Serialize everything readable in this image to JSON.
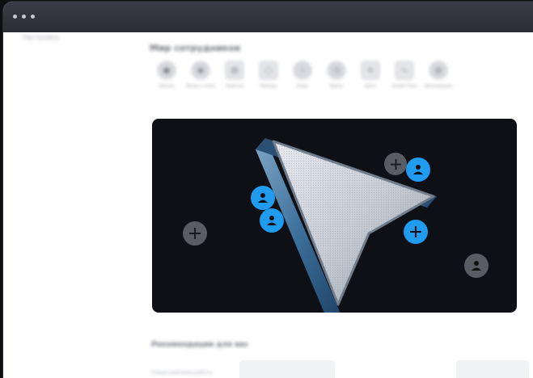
{
  "window": {
    "sidebar_label": "Настройки"
  },
  "features_section": {
    "title": "Мир сотрудников",
    "items": [
      {
        "label": "Личное",
        "icon": "circle-icon"
      },
      {
        "label": "Фокус и план",
        "icon": "target-icon"
      },
      {
        "label": "Заметки",
        "icon": "note-icon"
      },
      {
        "label": "Помощь",
        "icon": "square-icon"
      },
      {
        "label": "Инфо",
        "icon": "info-icon"
      },
      {
        "label": "Время",
        "icon": "clock-icon"
      },
      {
        "label": "Шаги",
        "icon": "steps-icon"
      },
      {
        "label": "Health Time",
        "icon": "wave-icon"
      },
      {
        "label": "Организация",
        "icon": "globe-icon"
      }
    ]
  },
  "hero": {
    "accent_color": "#1f9cf0",
    "circle_color": "#5a5c64",
    "bg_color": "#0f1016"
  },
  "recommendations": {
    "title": "Рекомендации для вас",
    "subtitle": "Новые шаблоны работы"
  }
}
